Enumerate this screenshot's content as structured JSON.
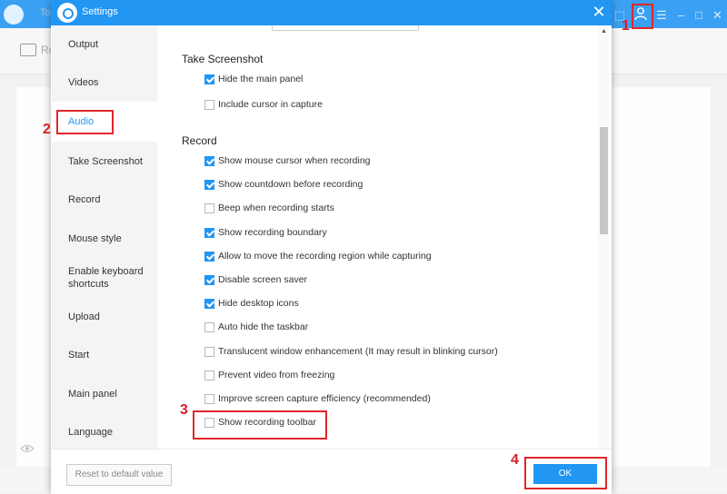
{
  "background": {
    "title_fragment": "To",
    "toolbar_fragment": "Re",
    "controls": [
      "⬚",
      "☰",
      "–",
      "□",
      "✕"
    ]
  },
  "dialog": {
    "title": "Settings",
    "close_symbol": "✕"
  },
  "sidebar": {
    "items": [
      {
        "label": "Output"
      },
      {
        "label": "Videos"
      },
      {
        "label": "Audio",
        "active": true
      },
      {
        "label": "Take Screenshot"
      },
      {
        "label": "Record"
      },
      {
        "label": "Mouse style"
      },
      {
        "label": "Enable keyboard shortcuts"
      },
      {
        "label": "Upload"
      },
      {
        "label": "Start"
      },
      {
        "label": "Main panel"
      },
      {
        "label": "Language"
      }
    ]
  },
  "sections": {
    "screenshot": {
      "title": "Take Screenshot",
      "options": [
        {
          "label": "Hide the main panel",
          "checked": true
        },
        {
          "label": "Include cursor in capture",
          "checked": false
        }
      ]
    },
    "record": {
      "title": "Record",
      "options": [
        {
          "label": "Show mouse cursor when recording",
          "checked": true
        },
        {
          "label": "Show countdown before recording",
          "checked": true
        },
        {
          "label": "Beep when recording starts",
          "checked": false
        },
        {
          "label": "Show recording boundary",
          "checked": true
        },
        {
          "label": "Allow to move the recording region while capturing",
          "checked": true
        },
        {
          "label": "Disable screen saver",
          "checked": true
        },
        {
          "label": "Hide desktop icons",
          "checked": true
        },
        {
          "label": "Auto hide the taskbar",
          "checked": false
        },
        {
          "label": "Translucent window enhancement (It may result in blinking cursor)",
          "checked": false
        },
        {
          "label": "Prevent video from freezing",
          "checked": false
        },
        {
          "label": "Improve screen capture efficiency (recommended)",
          "checked": false
        },
        {
          "label": "Show recording toolbar",
          "checked": false
        }
      ]
    }
  },
  "footer": {
    "reset_label": "Reset to default value",
    "ok_label": "OK"
  },
  "annotations": [
    "1",
    "2",
    "3",
    "4"
  ],
  "colors": {
    "accent": "#2196f3",
    "annotation_red": "#e0262b"
  }
}
